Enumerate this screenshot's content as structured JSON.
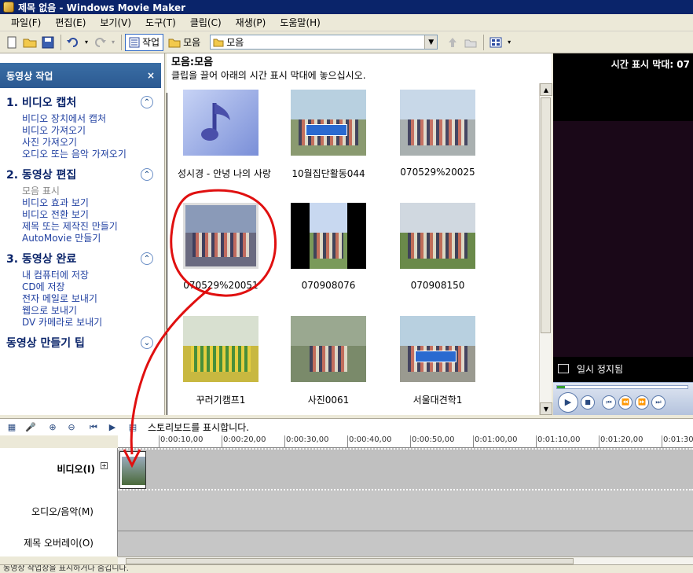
{
  "window": {
    "title": "제목 없음 - Windows Movie Maker"
  },
  "menu": [
    {
      "label": "파일(F)"
    },
    {
      "label": "편집(E)"
    },
    {
      "label": "보기(V)"
    },
    {
      "label": "도구(T)"
    },
    {
      "label": "클립(C)"
    },
    {
      "label": "재생(P)"
    },
    {
      "label": "도움말(H)"
    }
  ],
  "toolbar": {
    "tasks_label": "작업",
    "collections_label": "모음",
    "collection_select_value": "모음"
  },
  "taskpane": {
    "title": "동영상 작업",
    "close_glyph": "×",
    "sections": [
      {
        "title": "1. 비디오 캡처",
        "links": [
          "비디오 장치에서 캡처",
          "비디오 가져오기",
          "사진 가져오기",
          "오디오 또는 음악 가져오기"
        ]
      },
      {
        "title": "2. 동영상 편집",
        "links": [
          "모음 표시",
          "비디오 효과 보기",
          "비디오 전환 보기",
          "제목 또는 제작진 만들기",
          "AutoMovie 만들기"
        ]
      },
      {
        "title": "3. 동영상 완료",
        "links": [
          "내 컴퓨터에 저장",
          "CD에 저장",
          "전자 메일로 보내기",
          "웹으로 보내기",
          "DV 카메라로 보내기"
        ]
      }
    ],
    "tips_title": "동영상 만들기 팁"
  },
  "collection": {
    "title": "모음:모음",
    "subtitle": "클립을 끌어 아래의 시간 표시 막대에 놓으십시오.",
    "clips": [
      {
        "name": "성시경 - 안녕 나의 사랑",
        "kind": "music"
      },
      {
        "name": "10월집단활동044",
        "kind": "photo"
      },
      {
        "name": "070529%20025",
        "kind": "photo"
      },
      {
        "name": "070529%20051",
        "kind": "photo"
      },
      {
        "name": "070908076",
        "kind": "photo"
      },
      {
        "name": "070908150",
        "kind": "photo"
      },
      {
        "name": "꾸러기캠프1",
        "kind": "photo"
      },
      {
        "name": "사진0061",
        "kind": "photo"
      },
      {
        "name": "서울대견학1",
        "kind": "photo"
      }
    ]
  },
  "monitor": {
    "title": "시간 표시 막대: 07",
    "status": "일시 정지됨"
  },
  "timeline": {
    "storyboard_label": "스토리보드를 표시합니다.",
    "ticks": [
      "0:00:10,00",
      "0:00:20,00",
      "0:00:30,00",
      "0:00:40,00",
      "0:00:50,00",
      "0:01:00,00",
      "0:01:10,00",
      "0:01:20,00",
      "0:01:30"
    ],
    "tracks": {
      "video": "비디오(I)",
      "audio": "오디오/음악(M)",
      "overlay": "제목 오버레이(O)"
    }
  },
  "status_bar": "동영상 작업창을 표시하거나 숨깁니다."
}
